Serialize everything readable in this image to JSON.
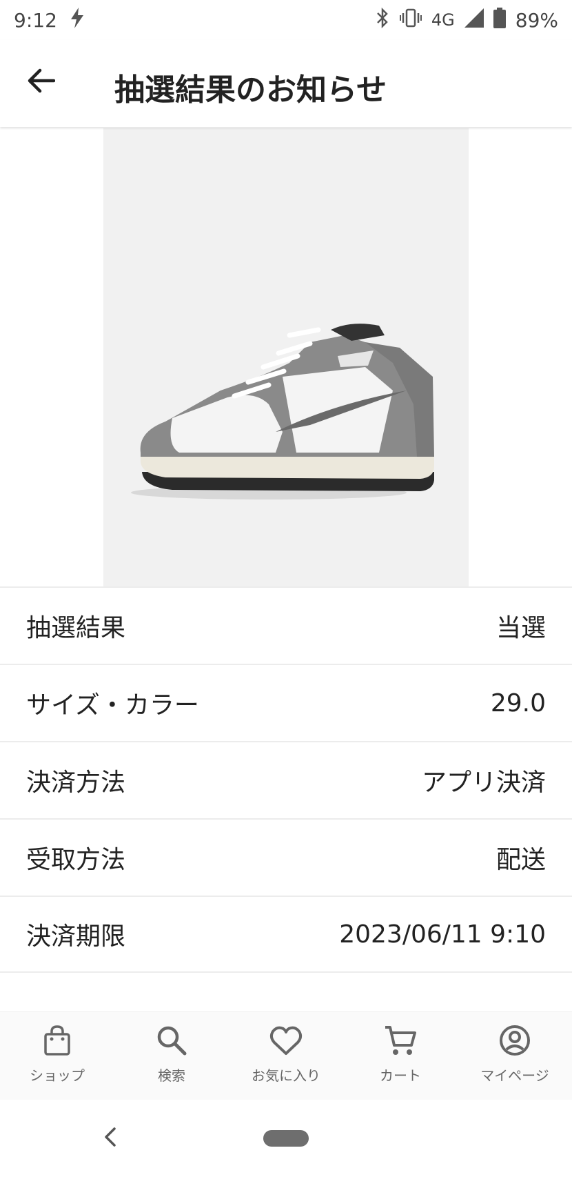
{
  "status_bar": {
    "time": "9:12",
    "network": "4G",
    "battery": "89%",
    "icons": [
      "flash-icon",
      "bluetooth-icon",
      "vibrate-icon",
      "signal-icon",
      "battery-icon"
    ]
  },
  "header": {
    "title": "抽選結果のお知らせ",
    "back_icon": "arrow-back-icon"
  },
  "product_image": {
    "description_icon": "sneaker-image"
  },
  "details": [
    {
      "label": "抽選結果",
      "value": "当選"
    },
    {
      "label": "サイズ・カラー",
      "value": "29.0"
    },
    {
      "label": "決済方法",
      "value": "アプリ決済"
    },
    {
      "label": "受取方法",
      "value": "配送"
    },
    {
      "label": "決済期限",
      "value": "2023/06/11 9:10"
    }
  ],
  "bottom_nav": [
    {
      "label": "ショップ",
      "icon": "shopping-bag-icon"
    },
    {
      "label": "検索",
      "icon": "search-icon"
    },
    {
      "label": "お気に入り",
      "icon": "heart-icon"
    },
    {
      "label": "カート",
      "icon": "cart-icon"
    },
    {
      "label": "マイページ",
      "icon": "account-icon"
    }
  ],
  "colors": {
    "accent": "#222222",
    "nav_icon": "#666666",
    "divider": "#ececec",
    "image_bg": "#f1f1f1"
  }
}
